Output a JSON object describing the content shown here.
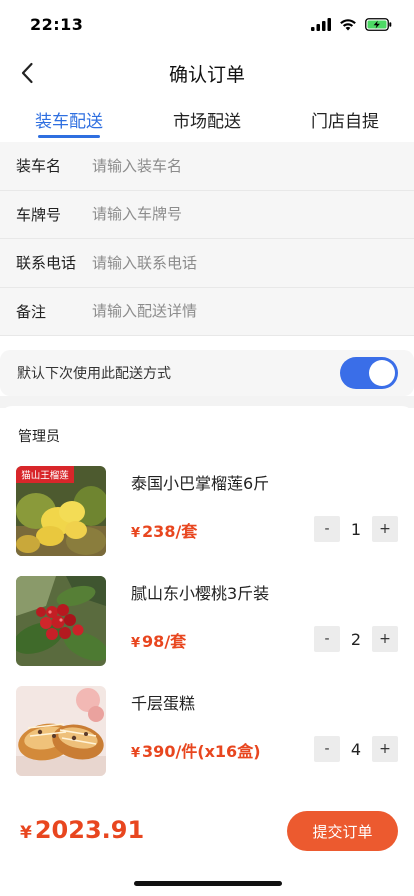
{
  "status_bar": {
    "time": "22:13"
  },
  "nav": {
    "title": "确认订单"
  },
  "tabs": [
    {
      "label": "装车配送",
      "active": true
    },
    {
      "label": "市场配送",
      "active": false
    },
    {
      "label": "门店自提",
      "active": false
    }
  ],
  "form": {
    "fields": [
      {
        "label": "装车名",
        "placeholder": "请输入装车名",
        "value": ""
      },
      {
        "label": "车牌号",
        "placeholder": "请输入车牌号",
        "value": ""
      },
      {
        "label": "联系电话",
        "placeholder": "请输入联系电话",
        "value": ""
      },
      {
        "label": "备注",
        "placeholder": "请输入配送详情",
        "value": ""
      }
    ]
  },
  "default_delivery": {
    "label": "默认下次使用此配送方式",
    "enabled": true
  },
  "order": {
    "section_title": "管理员",
    "currency": "¥",
    "products": [
      {
        "name": "泰国小巴掌榴莲6斤",
        "price": "238/套",
        "quantity": "1",
        "image_label": "猫山王榴莲"
      },
      {
        "name": "腻山东小樱桃3斤装",
        "price": "98/套",
        "quantity": "2"
      },
      {
        "name": "千层蛋糕",
        "price": "390/件(x16盒)",
        "quantity": "4"
      }
    ],
    "stepper": {
      "minus": "-",
      "plus": "+"
    }
  },
  "footer": {
    "currency": "¥",
    "total": "2023.91",
    "submit_label": "提交订单"
  },
  "colors": {
    "accent_blue": "#2f6fe0",
    "price_red": "#e8461f",
    "submit_orange": "#ec5a2f"
  }
}
